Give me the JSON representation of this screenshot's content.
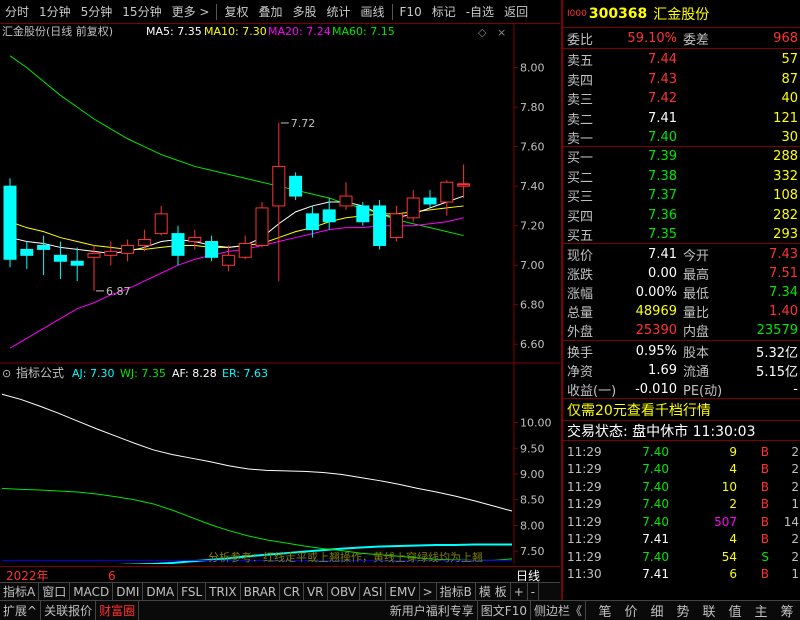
{
  "toolbar": {
    "items": [
      "分时",
      "1分钟",
      "5分钟",
      "15分钟",
      "更多 >",
      "复权",
      "叠加",
      "多股",
      "统计",
      "画线",
      "F10",
      "标记",
      "-自选",
      "返回"
    ]
  },
  "main_chart": {
    "title": "汇金股份(日线 前复权)",
    "ma5": "MA5: 7.35",
    "ma10": "MA10: 7.30",
    "ma20": "MA20: 7.24",
    "ma60": "MA60: 7.15",
    "high_label": "7.72",
    "low_label": "6.87",
    "y_ticks": [
      "8.00",
      "7.80",
      "7.60",
      "7.40",
      "7.20",
      "7.00",
      "6.80",
      "6.60"
    ],
    "colors": {
      "up": "#ff3232",
      "down": "#00ffff",
      "ma5": "#ffffff",
      "ma10": "#ffff00",
      "ma20": "#ff00ff",
      "ma60": "#00e600"
    }
  },
  "indicator": {
    "title": "指标公式",
    "aj": "AJ: 7.30",
    "wj": "WJ: 7.35",
    "af": "AF: 8.28",
    "er": "ER: 7.63",
    "y_ticks": [
      "10.00",
      "9.50",
      "9.00",
      "8.50",
      "8.00",
      "7.50"
    ],
    "note": "分析参考：红线走平或上翘操作，黄线上穿绿线均为上翘"
  },
  "time_axis": {
    "year": "2022年",
    "month": "6",
    "period": "日线"
  },
  "chart_data": {
    "type": "line",
    "title": "汇金股份(日线 前复权)",
    "candles": [
      {
        "o": 7.4,
        "h": 7.44,
        "c": 7.03,
        "l": 6.99
      },
      {
        "o": 7.08,
        "h": 7.12,
        "c": 7.05,
        "l": 6.98
      },
      {
        "o": 7.1,
        "h": 7.15,
        "c": 7.08,
        "l": 6.95
      },
      {
        "o": 7.05,
        "h": 7.12,
        "c": 7.02,
        "l": 6.93
      },
      {
        "o": 7.02,
        "h": 7.09,
        "c": 7.0,
        "l": 6.92
      },
      {
        "o": 7.04,
        "h": 7.1,
        "c": 7.06,
        "l": 6.87
      },
      {
        "o": 7.05,
        "h": 7.12,
        "c": 7.07,
        "l": 7.0
      },
      {
        "o": 7.06,
        "h": 7.13,
        "c": 7.1,
        "l": 7.02
      },
      {
        "o": 7.1,
        "h": 7.18,
        "c": 7.13,
        "l": 7.07
      },
      {
        "o": 7.16,
        "h": 7.3,
        "c": 7.26,
        "l": 7.15
      },
      {
        "o": 7.16,
        "h": 7.2,
        "c": 7.05,
        "l": 7.0
      },
      {
        "o": 7.12,
        "h": 7.18,
        "c": 7.14,
        "l": 7.08
      },
      {
        "o": 7.12,
        "h": 7.15,
        "c": 7.04,
        "l": 7.02
      },
      {
        "o": 7.0,
        "h": 7.1,
        "c": 7.05,
        "l": 6.97
      },
      {
        "o": 7.04,
        "h": 7.15,
        "c": 7.11,
        "l": 7.03
      },
      {
        "o": 7.1,
        "h": 7.32,
        "c": 7.29,
        "l": 7.09
      },
      {
        "o": 7.3,
        "h": 7.72,
        "c": 7.5,
        "l": 6.92
      },
      {
        "o": 7.45,
        "h": 7.47,
        "c": 7.35,
        "l": 7.33
      },
      {
        "o": 7.26,
        "h": 7.3,
        "c": 7.18,
        "l": 7.14
      },
      {
        "o": 7.28,
        "h": 7.34,
        "c": 7.22,
        "l": 7.18
      },
      {
        "o": 7.3,
        "h": 7.42,
        "c": 7.35,
        "l": 7.28
      },
      {
        "o": 7.3,
        "h": 7.32,
        "c": 7.22,
        "l": 7.2
      },
      {
        "o": 7.3,
        "h": 7.33,
        "c": 7.1,
        "l": 7.08
      },
      {
        "o": 7.14,
        "h": 7.3,
        "c": 7.26,
        "l": 7.12
      },
      {
        "o": 7.24,
        "h": 7.38,
        "c": 7.34,
        "l": 7.22
      },
      {
        "o": 7.34,
        "h": 7.38,
        "c": 7.31,
        "l": 7.29
      },
      {
        "o": 7.32,
        "h": 7.43,
        "c": 7.42,
        "l": 7.25
      },
      {
        "o": 7.4,
        "h": 7.51,
        "c": 7.41,
        "l": 7.34
      }
    ],
    "ma5": [
      7.14,
      7.12,
      7.11,
      7.09,
      7.08,
      7.07,
      7.06,
      7.07,
      7.09,
      7.12,
      7.13,
      7.12,
      7.1,
      7.09,
      7.1,
      7.14,
      7.21,
      7.27,
      7.3,
      7.32,
      7.32,
      7.3,
      7.26,
      7.24,
      7.26,
      7.29,
      7.32,
      7.35
    ],
    "ma10": [
      7.22,
      7.19,
      7.17,
      7.14,
      7.12,
      7.1,
      7.09,
      7.08,
      7.08,
      7.09,
      7.1,
      7.1,
      7.09,
      7.09,
      7.1,
      7.11,
      7.14,
      7.17,
      7.19,
      7.22,
      7.24,
      7.25,
      7.26,
      7.26,
      7.27,
      7.28,
      7.29,
      7.3
    ],
    "ma20": [
      6.58,
      6.63,
      6.68,
      6.73,
      6.78,
      6.81,
      6.85,
      6.88,
      6.92,
      6.96,
      7.0,
      7.03,
      7.05,
      7.07,
      7.08,
      7.1,
      7.12,
      7.14,
      7.16,
      7.18,
      7.19,
      7.19,
      7.2,
      7.2,
      7.2,
      7.21,
      7.22,
      7.24
    ],
    "ma60": [
      8.06,
      8.0,
      7.93,
      7.86,
      7.8,
      7.74,
      7.69,
      7.64,
      7.6,
      7.56,
      7.53,
      7.5,
      7.48,
      7.46,
      7.44,
      7.42,
      7.4,
      7.38,
      7.36,
      7.34,
      7.31,
      7.29,
      7.26,
      7.23,
      7.21,
      7.19,
      7.17,
      7.15
    ],
    "indicator_series": [
      {
        "name": "AJ",
        "color": "#00ffff",
        "values": [
          7.23,
          7.23,
          7.23,
          7.23,
          7.23,
          7.23,
          7.23,
          7.24,
          7.25,
          7.27,
          7.3,
          7.33,
          7.36,
          7.4,
          7.43,
          7.46,
          7.49,
          7.52,
          7.55,
          7.57,
          7.59,
          7.6,
          7.61,
          7.62,
          7.62,
          7.63,
          7.63,
          7.63
        ]
      },
      {
        "name": "WJ",
        "color": "#00e600",
        "values": [
          8.72,
          8.7,
          8.69,
          8.67,
          8.65,
          8.61,
          8.56,
          8.5,
          8.42,
          8.3,
          8.16,
          8.02,
          7.9,
          7.8,
          7.72,
          7.66,
          7.6,
          7.55,
          7.51,
          7.46,
          7.43,
          7.4,
          7.37,
          7.34,
          7.33,
          7.32,
          7.32,
          7.35
        ]
      },
      {
        "name": "AF",
        "color": "#ffffff",
        "values": [
          10.55,
          10.45,
          10.32,
          10.18,
          10.03,
          9.88,
          9.74,
          9.6,
          9.47,
          9.38,
          9.31,
          9.24,
          9.16,
          9.1,
          9.07,
          9.06,
          9.05,
          9.03,
          8.99,
          8.93,
          8.87,
          8.8,
          8.72,
          8.65,
          8.57,
          8.48,
          8.38,
          8.28
        ]
      },
      {
        "name": "ER",
        "color": "#0000ff",
        "values": [
          7.32,
          7.32,
          7.32,
          7.32,
          7.32,
          7.32,
          7.32,
          7.32,
          7.32,
          7.32,
          7.32,
          7.32,
          7.32,
          7.32,
          7.32,
          7.32,
          7.32,
          7.32,
          7.32,
          7.32,
          7.32,
          7.32,
          7.32,
          7.32,
          7.32,
          7.32,
          7.32,
          7.32
        ]
      }
    ],
    "ylim_main": [
      6.5,
      8.15
    ],
    "ylim_indicator": [
      7.25,
      10.75
    ]
  },
  "quote": {
    "code": "300368",
    "name": "汇金股份",
    "weibi_label": "委比",
    "weibi": "59.10%",
    "weicha_label": "委差",
    "weicha": "968",
    "asks": [
      {
        "label": "卖五",
        "price": "7.44",
        "vol": "57"
      },
      {
        "label": "卖四",
        "price": "7.43",
        "vol": "87"
      },
      {
        "label": "卖三",
        "price": "7.42",
        "vol": "40"
      },
      {
        "label": "卖二",
        "price": "7.41",
        "vol": "121"
      },
      {
        "label": "卖一",
        "price": "7.40",
        "vol": "30"
      }
    ],
    "bids": [
      {
        "label": "买一",
        "price": "7.39",
        "vol": "288"
      },
      {
        "label": "买二",
        "price": "7.38",
        "vol": "332"
      },
      {
        "label": "买三",
        "price": "7.37",
        "vol": "108"
      },
      {
        "label": "买四",
        "price": "7.36",
        "vol": "282"
      },
      {
        "label": "买五",
        "price": "7.35",
        "vol": "293"
      }
    ],
    "stats": [
      {
        "l1": "现价",
        "v1": "7.41",
        "c1": "white",
        "l2": "今开",
        "v2": "7.43",
        "c2": "red"
      },
      {
        "l1": "涨跌",
        "v1": "0.00",
        "c1": "white",
        "l2": "最高",
        "v2": "7.51",
        "c2": "red"
      },
      {
        "l1": "涨幅",
        "v1": "0.00%",
        "c1": "white",
        "l2": "最低",
        "v2": "7.34",
        "c2": "green"
      },
      {
        "l1": "总量",
        "v1": "48969",
        "c1": "yellow",
        "l2": "量比",
        "v2": "1.40",
        "c2": "red"
      },
      {
        "l1": "外盘",
        "v1": "25390",
        "c1": "red",
        "l2": "内盘",
        "v2": "23579",
        "c2": "green"
      }
    ],
    "stats2": [
      {
        "l1": "换手",
        "v1": "0.95%",
        "l2": "股本",
        "v2": "5.32亿"
      },
      {
        "l1": "净资",
        "v1": "1.69",
        "l2": "流通",
        "v2": "5.15亿"
      },
      {
        "l1": "收益(一)",
        "v1": "-0.010",
        "l2": "PE(动)",
        "v2": "-"
      }
    ],
    "promo": "仅需20元查看千档行情",
    "trade_status": "交易状态: 盘中休市 11:30:03",
    "ticks": [
      {
        "t": "11:29",
        "p": "7.40",
        "pc": "green",
        "v": "9",
        "vc": "yellow",
        "bs": "B",
        "bsc": "red",
        "n": "2"
      },
      {
        "t": "11:29",
        "p": "7.40",
        "pc": "green",
        "v": "4",
        "vc": "yellow",
        "bs": "B",
        "bsc": "red",
        "n": "2"
      },
      {
        "t": "11:29",
        "p": "7.40",
        "pc": "green",
        "v": "10",
        "vc": "yellow",
        "bs": "B",
        "bsc": "red",
        "n": "2"
      },
      {
        "t": "11:29",
        "p": "7.40",
        "pc": "green",
        "v": "2",
        "vc": "yellow",
        "bs": "B",
        "bsc": "red",
        "n": "1"
      },
      {
        "t": "11:29",
        "p": "7.40",
        "pc": "green",
        "v": "507",
        "vc": "magenta",
        "bs": "B",
        "bsc": "red",
        "n": "14"
      },
      {
        "t": "11:29",
        "p": "7.41",
        "pc": "white",
        "v": "4",
        "vc": "yellow",
        "bs": "B",
        "bsc": "red",
        "n": "2"
      },
      {
        "t": "11:29",
        "p": "7.40",
        "pc": "green",
        "v": "54",
        "vc": "yellow",
        "bs": "S",
        "bsc": "green",
        "n": "2"
      },
      {
        "t": "11:30",
        "p": "7.41",
        "pc": "white",
        "v": "6",
        "vc": "yellow",
        "bs": "B",
        "bsc": "red",
        "n": "1"
      }
    ]
  },
  "bottom_tabs_1": [
    "指标A",
    "窗口",
    "MACD",
    "DMI",
    "DMA",
    "FSL",
    "TRIX",
    "BRAR",
    "CR",
    "VR",
    "OBV",
    "ASI",
    "EMV",
    ">",
    "指标B",
    "模 板",
    "+",
    "-"
  ],
  "bottom_tabs_2": [
    "扩展^",
    "关联报价",
    "财富圈",
    "新用户福利专享",
    "图文F10",
    "侧边栏《"
  ],
  "bottom_icons": [
    "笔",
    "价",
    "细",
    "势",
    "联",
    "值",
    "主",
    "筹"
  ]
}
